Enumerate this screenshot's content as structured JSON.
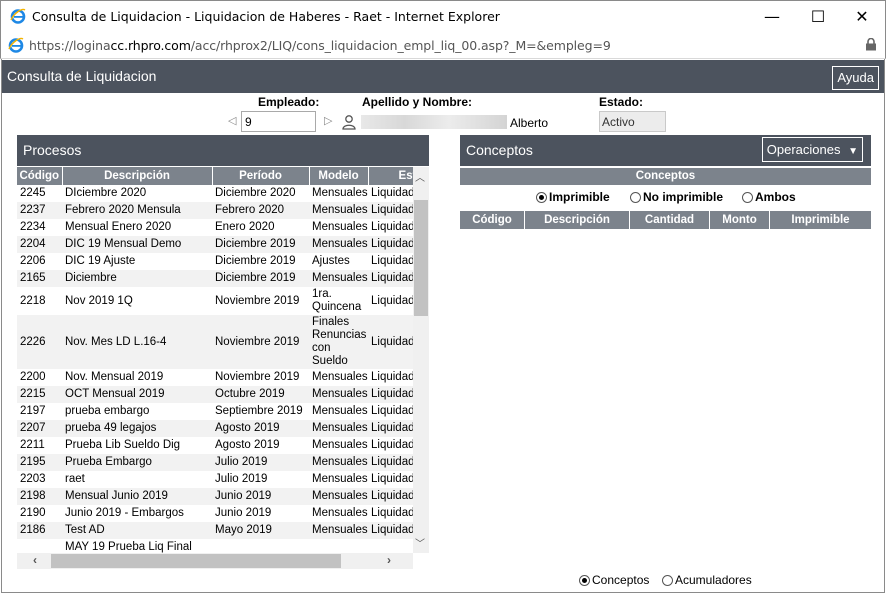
{
  "window": {
    "title": "Consulta de Liquidacion - Liquidacion de Haberes - Raet - Internet Explorer",
    "url_prefix": "https://logina",
    "url_host": "cc.rhpro.com",
    "url_path": "/acc/rhprox2/LIQ/cons_liquidacion_empl_liq_00.asp?_M=&empleg=9",
    "minimize": "—",
    "maximize": "☐",
    "close": "✕"
  },
  "header": {
    "title": "Consulta de Liquidacion",
    "help_label": "Ayuda"
  },
  "employee": {
    "empleado_label": "Empleado:",
    "empleado_value": "9",
    "nombre_label": "Apellido y Nombre:",
    "nombre_visible": "Alberto",
    "estado_label": "Estado:",
    "estado_value": "Activo"
  },
  "procesos": {
    "title": "Procesos",
    "columns": [
      "Código",
      "Descripción",
      "Período",
      "Modelo",
      "Est"
    ],
    "rows": [
      [
        "2245",
        "DIciembre 2020",
        "Diciembre 2020",
        "Mensuales",
        "Liquidad"
      ],
      [
        "2237",
        "Febrero 2020 Mensula",
        "Febrero 2020",
        "Mensuales",
        "Liquidad"
      ],
      [
        "2234",
        "Mensual Enero 2020",
        "Enero 2020",
        "Mensuales",
        "Liquidad"
      ],
      [
        "2204",
        "DIC 19 Mensual Demo",
        "Diciembre 2019",
        "Mensuales",
        "Liquidad"
      ],
      [
        "2206",
        "DIC 19 Ajuste",
        "Diciembre 2019",
        "Ajustes",
        "Liquidad"
      ],
      [
        "2165",
        "Diciembre",
        "Diciembre 2019",
        "Mensuales",
        "Liquidad"
      ],
      [
        "2218",
        "Nov 2019 1Q",
        "Noviembre 2019",
        "1ra. Quincena",
        "Liquidad"
      ],
      [
        "2226",
        "Nov. Mes LD L.16-4",
        "Noviembre 2019",
        "Finales Renuncias con Sueldo",
        "Liquidad"
      ],
      [
        "2200",
        "Nov. Mensual 2019",
        "Noviembre 2019",
        "Mensuales",
        "Liquidad"
      ],
      [
        "2215",
        "OCT Mensual 2019",
        "Octubre 2019",
        "Mensuales",
        "Liquidad"
      ],
      [
        "2197",
        "prueba embargo",
        "Septiembre 2019",
        "Mensuales",
        "Liquidad"
      ],
      [
        "2207",
        "prueba 49 legajos",
        "Agosto 2019",
        "Mensuales",
        "Liquidad"
      ],
      [
        "2211",
        "Prueba Lib Sueldo Dig",
        "Agosto 2019",
        "Mensuales",
        "Liquidad"
      ],
      [
        "2195",
        "Prueba Embargo",
        "Julio 2019",
        "Mensuales",
        "Liquidad"
      ],
      [
        "2203",
        "raet",
        "Julio 2019",
        "Mensuales",
        "Liquidad"
      ],
      [
        "2198",
        "Mensual Junio 2019",
        "Junio 2019",
        "Mensuales",
        "Liquidad"
      ],
      [
        "2190",
        "Junio 2019 - Embargos",
        "Junio 2019",
        "Mensuales",
        "Liquidad"
      ],
      [
        "2186",
        "Test AD",
        "Mayo 2019",
        "Mensuales",
        "Liquidad"
      ],
      [
        "",
        "MAY 19 Prueba Liq Final",
        "",
        "",
        ""
      ]
    ]
  },
  "conceptos": {
    "title": "Conceptos",
    "operations_label": "Operaciones",
    "subheader": "Conceptos",
    "filters": [
      "Imprimible",
      "No imprimible",
      "Ambos"
    ],
    "columns": [
      "Código",
      "Descripción",
      "Cantidad",
      "Monto",
      "Imprimible"
    ]
  },
  "view_toggle": [
    "Conceptos",
    "Acumuladores"
  ]
}
